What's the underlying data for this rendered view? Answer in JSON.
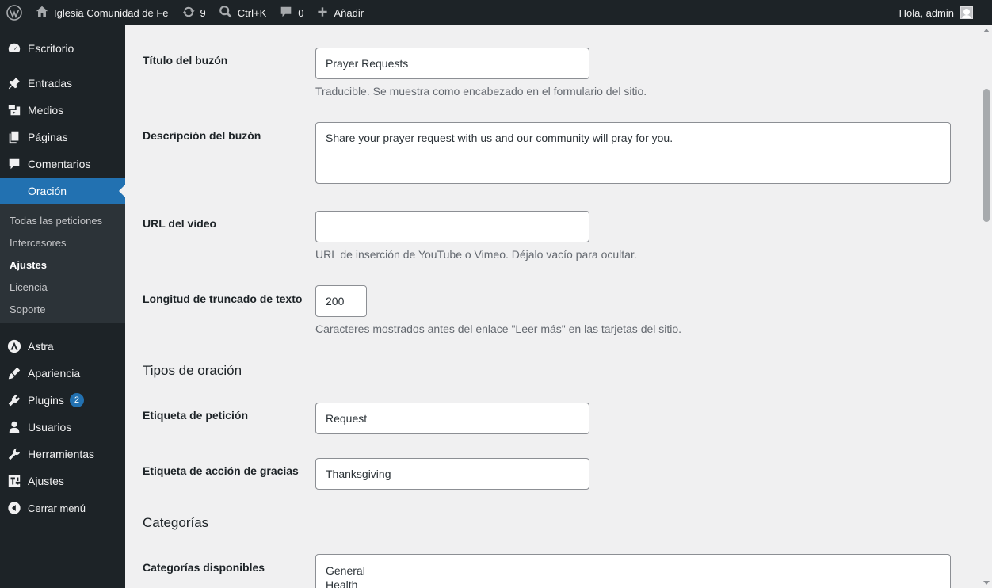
{
  "adminbar": {
    "site_name": "Iglesia Comunidad de Fe",
    "updates_count": "9",
    "search_shortcut": "Ctrl+K",
    "comments_count": "0",
    "add_new": "Añadir",
    "greeting": "Hola, admin"
  },
  "sidebar": {
    "items": [
      {
        "label": "Escritorio",
        "icon": "dashboard-icon"
      },
      {
        "label": "Entradas",
        "icon": "pin-icon"
      },
      {
        "label": "Medios",
        "icon": "media-icon"
      },
      {
        "label": "Páginas",
        "icon": "pages-icon"
      },
      {
        "label": "Comentarios",
        "icon": "comments-icon"
      },
      {
        "label": "Oración",
        "icon": ""
      },
      {
        "label": "Astra",
        "icon": "astra-icon"
      },
      {
        "label": "Apariencia",
        "icon": "appearance-icon"
      },
      {
        "label": "Plugins",
        "icon": "plugins-icon",
        "badge": "2"
      },
      {
        "label": "Usuarios",
        "icon": "users-icon"
      },
      {
        "label": "Herramientas",
        "icon": "tools-icon"
      },
      {
        "label": "Ajustes",
        "icon": "settings-icon"
      },
      {
        "label": "Cerrar menú",
        "icon": "collapse-icon"
      }
    ],
    "submenu": [
      {
        "label": "Todas las peticiones"
      },
      {
        "label": "Intercesores"
      },
      {
        "label": "Ajustes"
      },
      {
        "label": "Licencia"
      },
      {
        "label": "Soporte"
      }
    ]
  },
  "form": {
    "mailbox_title": {
      "label": "Título del buzón",
      "value": "Prayer Requests",
      "desc": "Traducible. Se muestra como encabezado en el formulario del sitio."
    },
    "mailbox_description": {
      "label": "Descripción del buzón",
      "value": "Share your prayer request with us and our community will pray for you."
    },
    "video_url": {
      "label": "URL del vídeo",
      "value": "",
      "desc": "URL de inserción de YouTube o Vimeo. Déjalo vacío para ocultar."
    },
    "truncate_length": {
      "label": "Longitud de truncado de texto",
      "value": "200",
      "desc": "Caracteres mostrados antes del enlace \"Leer más\" en las tarjetas del sitio."
    },
    "prayer_types_heading": "Tipos de oración",
    "request_label": {
      "label": "Etiqueta de petición",
      "value": "Request"
    },
    "thanksgiving_label": {
      "label": "Etiqueta de acción de gracias",
      "value": "Thanksgiving"
    },
    "categories_heading": "Categorías",
    "available_categories": {
      "label": "Categorías disponibles",
      "values": [
        "General",
        "Health"
      ]
    }
  }
}
